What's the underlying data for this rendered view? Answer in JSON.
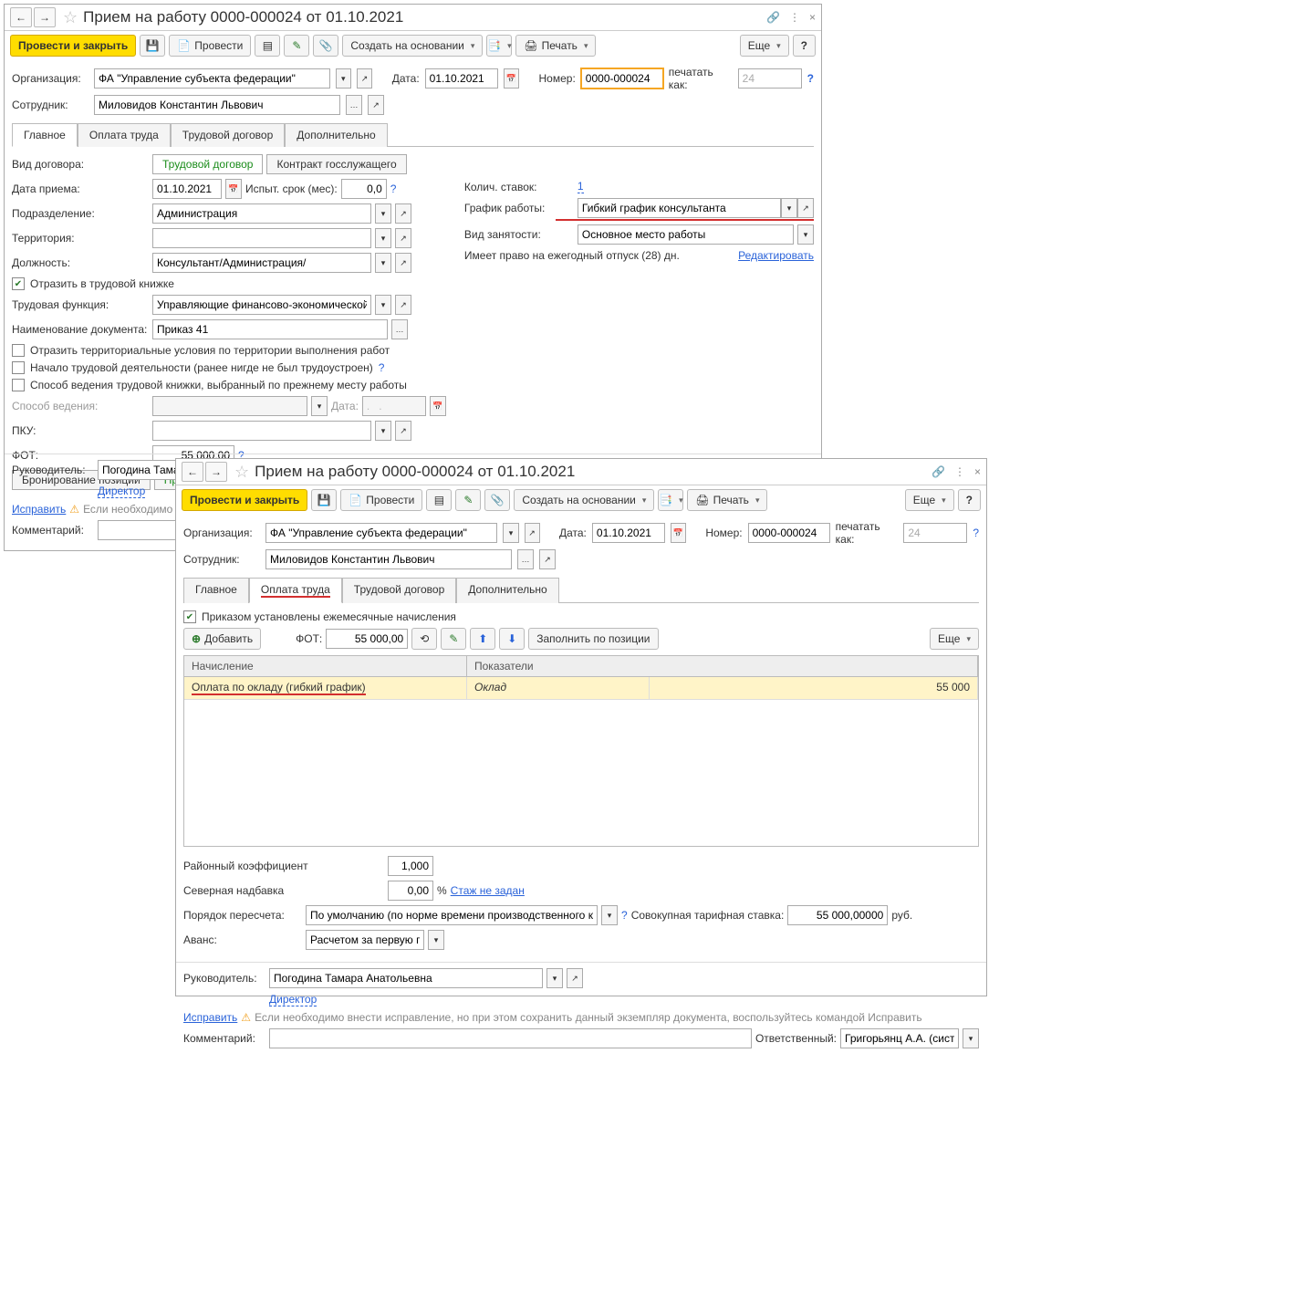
{
  "win1": {
    "title": "Прием на работу 0000-000024 от 01.10.2021",
    "toolbar": {
      "post_close": "Провести и закрыть",
      "post": "Провести",
      "create_based": "Создать на основании",
      "print": "Печать",
      "more": "Еще",
      "help": "?"
    },
    "header": {
      "org_label": "Организация:",
      "org_value": "ФА \"Управление субъекта федерации\"",
      "date_label": "Дата:",
      "date_value": "01.10.2021",
      "num_label": "Номер:",
      "num_value": "0000-000024",
      "print_as_label": "печатать как:",
      "print_as_value": "24",
      "employee_label": "Сотрудник:",
      "employee_value": "Миловидов Константин Львович"
    },
    "tabs": [
      "Главное",
      "Оплата труда",
      "Трудовой договор",
      "Дополнительно"
    ],
    "main": {
      "contract_type_label": "Вид договора:",
      "contract_labor": "Трудовой договор",
      "contract_civil": "Контракт госслужащего",
      "hire_date_label": "Дата приема:",
      "hire_date_value": "01.10.2021",
      "probation_label": "Испыт. срок (мес):",
      "probation_value": "0,0",
      "dept_label": "Подразделение:",
      "dept_value": "Администрация",
      "territory_label": "Территория:",
      "position_label": "Должность:",
      "position_value": "Консультант/Администрация/",
      "reflect_label": "Отразить в трудовой книжке",
      "labor_func_label": "Трудовая функция:",
      "labor_func_value": "Управляющие финансово-экономической и административн",
      "doc_name_label": "Наименование документа:",
      "doc_name_value": "Приказ 41",
      "chk_territory": "Отразить территориальные условия по территории выполнения работ",
      "chk_first_job": "Начало трудовой деятельности (ранее нигде не был трудоустроен)",
      "chk_book_method": "Способ ведения трудовой книжки, выбранный по прежнему месту работы",
      "method_label": "Способ ведения:",
      "method_date_label": "Дата:",
      "method_date_placeholder": ".   .",
      "pku_label": "ПКУ:",
      "fot_label": "ФОТ:",
      "fot_value": "55 000,00",
      "seg_book": "Бронирование позиции",
      "seg_hire": "Прием на работу",
      "rates_label": "Колич. ставок:",
      "rates_value": "1",
      "schedule_label": "График работы:",
      "schedule_value": "Гибкий график консультанта",
      "emp_type_label": "Вид занятости:",
      "emp_type_value": "Основное место работы",
      "vacation_text": "Имеет право на ежегодный отпуск (28) дн.",
      "edit_link": "Редактировать"
    },
    "footer": {
      "head_label": "Руководитель:",
      "head_value": "Погодина Тамара Анат",
      "director": "Директор",
      "fix_link": "Исправить",
      "warn_text": "Если необходимо внест",
      "comment_label": "Комментарий:"
    }
  },
  "win2": {
    "title": "Прием на работу 0000-000024 от 01.10.2021",
    "toolbar": {
      "post_close": "Провести и закрыть",
      "post": "Провести",
      "create_based": "Создать на основании",
      "print": "Печать",
      "more": "Еще",
      "help": "?"
    },
    "header": {
      "org_label": "Организация:",
      "org_value": "ФА \"Управление субъекта федерации\"",
      "date_label": "Дата:",
      "date_value": "01.10.2021",
      "num_label": "Номер:",
      "num_value": "0000-000024",
      "print_as_label": "печатать как:",
      "print_as_value": "24",
      "employee_label": "Сотрудник:",
      "employee_value": "Миловидов Константин Львович"
    },
    "tabs": [
      "Главное",
      "Оплата труда",
      "Трудовой договор",
      "Дополнительно"
    ],
    "pay": {
      "chk_monthly": "Приказом установлены ежемесячные начисления",
      "add_btn": "Добавить",
      "fot_label": "ФОТ:",
      "fot_value": "55 000,00",
      "fill_position": "Заполнить по позиции",
      "more": "Еще",
      "col1": "Начисление",
      "col2": "Показатели",
      "row_accrual": "Оплата по окладу (гибкий график)",
      "row_indicator": "Оклад",
      "row_value": "55 000",
      "district_coef_label": "Районный коэффициент",
      "district_coef_value": "1,000",
      "north_label": "Северная надбавка",
      "north_value": "0,00",
      "percent": "%",
      "stage_link": "Стаж не задан",
      "recalc_label": "Порядок пересчета:",
      "recalc_value": "По умолчанию (по норме времени производственного календар",
      "total_rate_label": "Совокупная тарифная ставка:",
      "total_rate_value": "55 000,00000",
      "rub": "руб.",
      "advance_label": "Аванс:",
      "advance_value": "Расчетом за первую пол"
    },
    "footer": {
      "head_label": "Руководитель:",
      "head_value": "Погодина Тамара Анатольевна",
      "director": "Директор",
      "fix_link": "Исправить",
      "warn_text": "Если необходимо внести исправление, но при этом сохранить данный экземпляр документа, воспользуйтесь командой Исправить",
      "comment_label": "Комментарий:",
      "resp_label": "Ответственный:",
      "resp_value": "Григорьянц А.А. (системн"
    }
  }
}
